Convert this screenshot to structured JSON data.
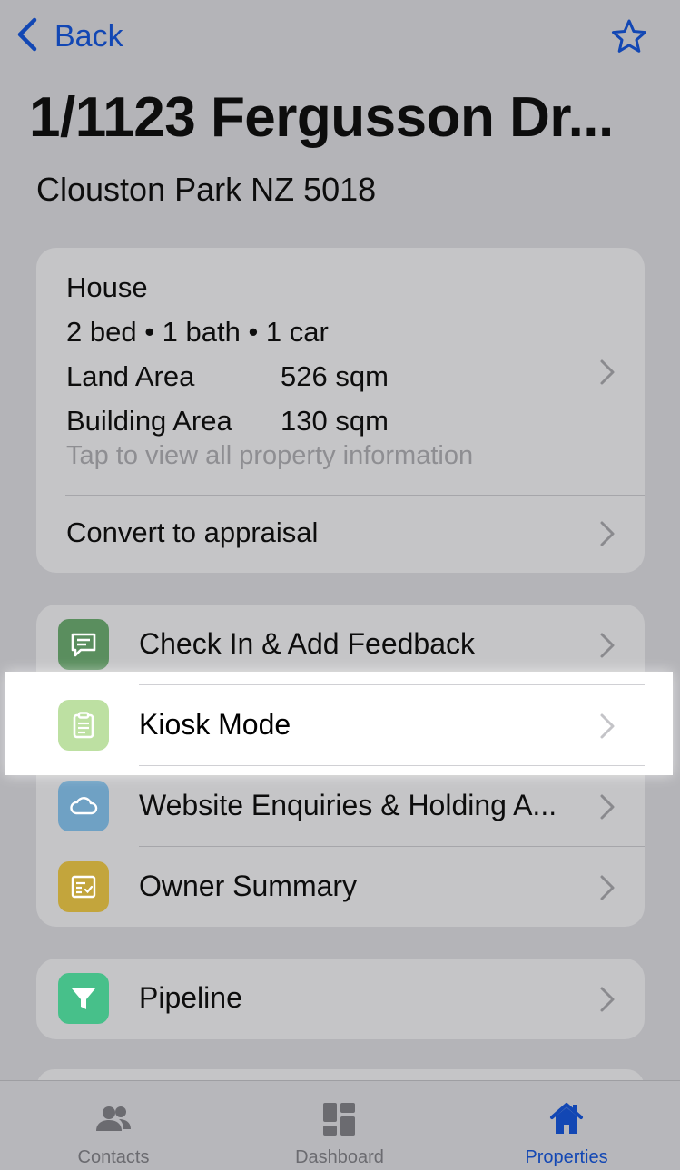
{
  "nav": {
    "back_label": "Back",
    "back_icon": "chevron-left-icon",
    "favorite_icon": "star-outline-icon",
    "accent": "#1247b4"
  },
  "header": {
    "title": "1/1123 Fergusson Dr...",
    "subtitle": "Clouston Park NZ 5018"
  },
  "summary": {
    "property_type": "House",
    "specs": "2 bed • 1 bath • 1 car",
    "land_area_label": "Land Area",
    "land_area_value": "526 sqm",
    "building_area_label": "Building Area",
    "building_area_value": "130 sqm",
    "hint": "Tap to view all property information",
    "convert_label": "Convert to appraisal"
  },
  "actions": [
    {
      "label": "Check In & Add Feedback",
      "icon": "message-icon",
      "color": "#5a8e5e"
    },
    {
      "label": "Kiosk Mode",
      "icon": "clipboard-icon",
      "color": "#bde0a2",
      "highlighted": true
    },
    {
      "label": "Website Enquiries & Holding A...",
      "icon": "cloud-icon",
      "color": "#6fa1c4"
    },
    {
      "label": "Owner Summary",
      "icon": "checklist-icon",
      "color": "#c3a53c"
    }
  ],
  "pipeline": {
    "label": "Pipeline",
    "icon": "funnel-icon",
    "color": "#47c08a"
  },
  "tabbar": {
    "tabs": [
      {
        "label": "Contacts",
        "icon": "people-icon",
        "active": false
      },
      {
        "label": "Dashboard",
        "icon": "dashboard-icon",
        "active": false
      },
      {
        "label": "Properties",
        "icon": "house-icon",
        "active": true
      }
    ]
  }
}
